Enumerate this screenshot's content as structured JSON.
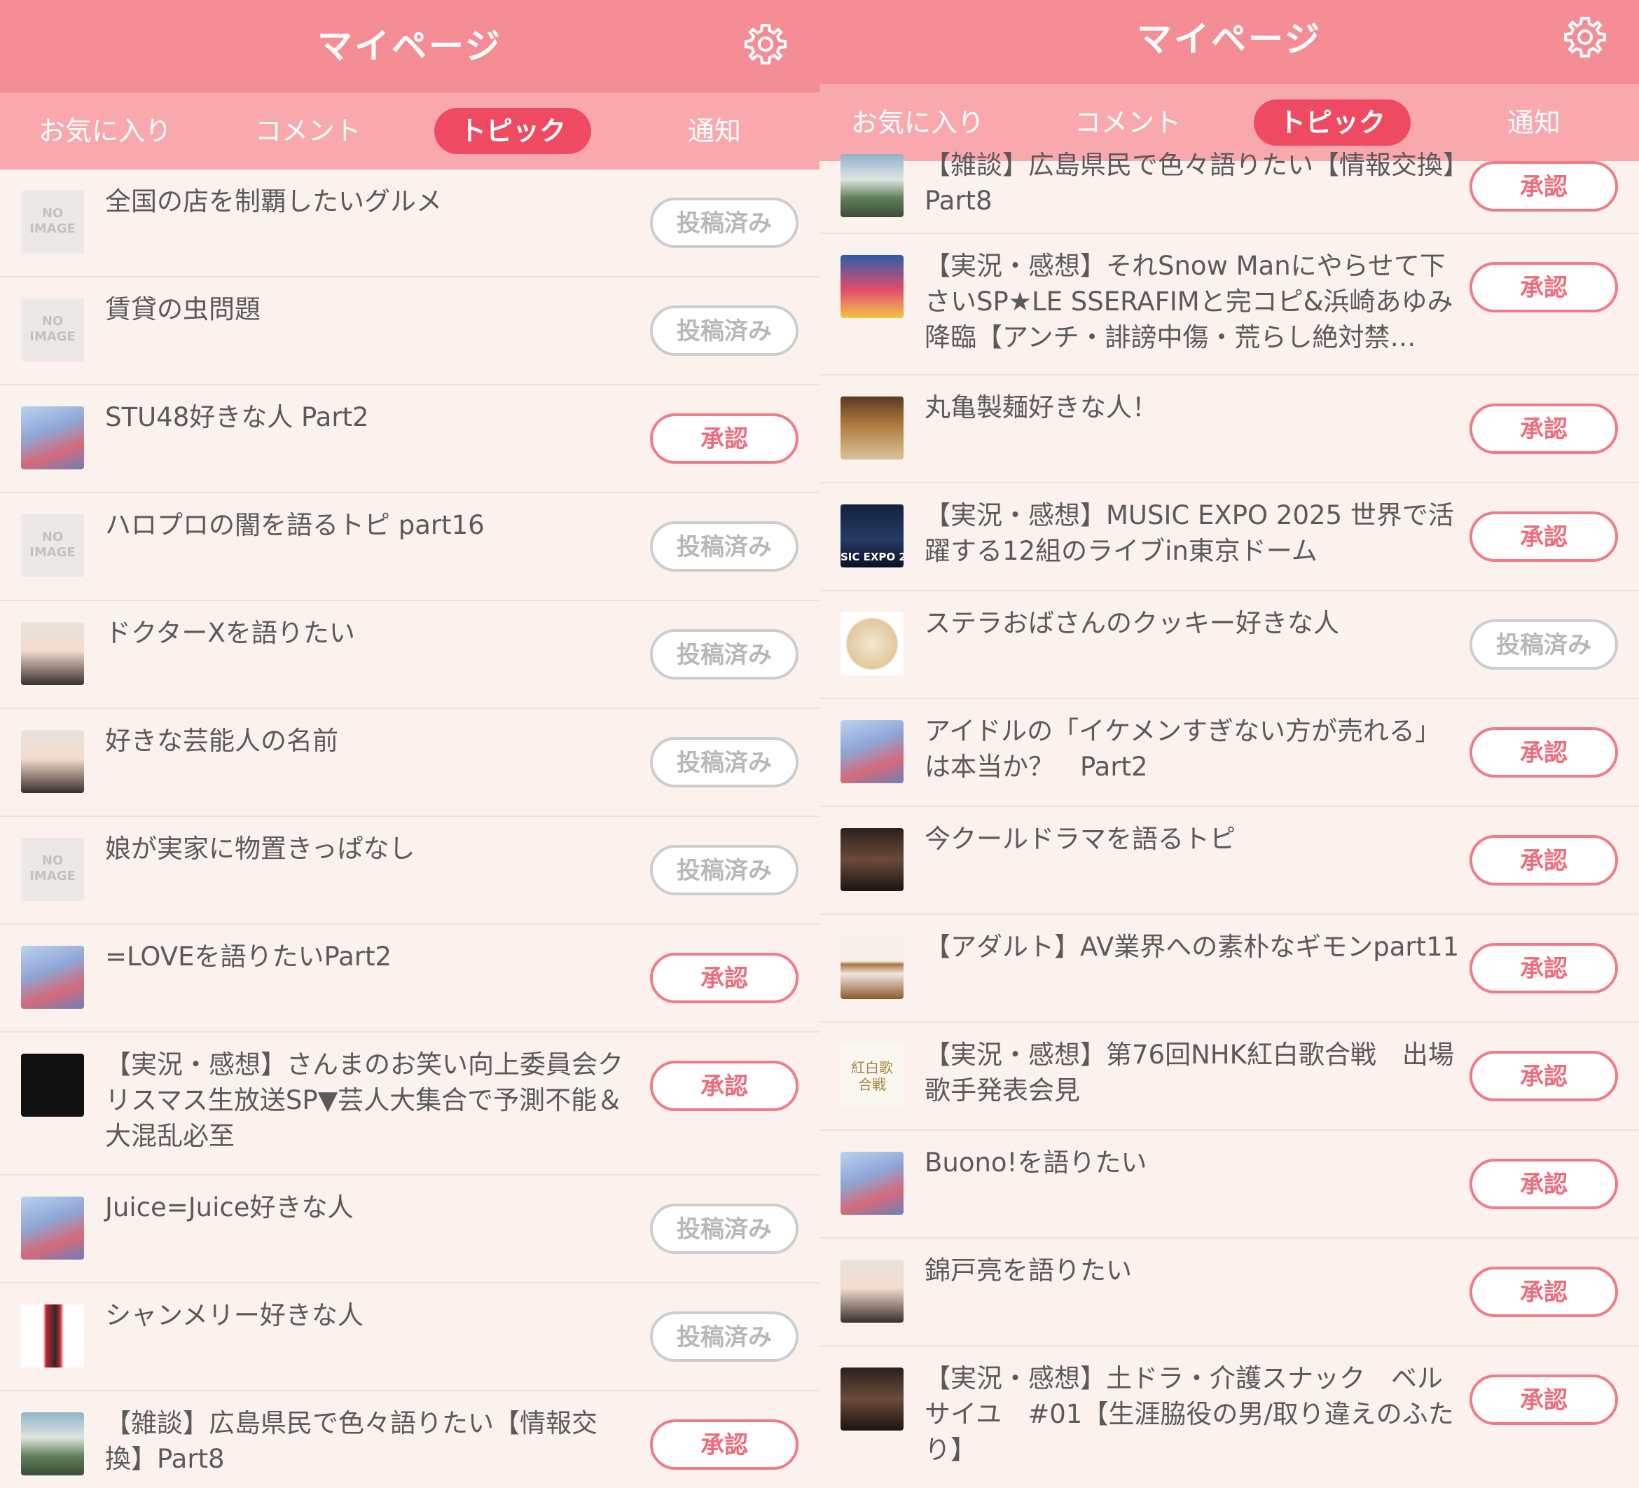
{
  "colors": {
    "header": "#f58d95",
    "tabs_bar": "#f9a9ae",
    "active_tab": "#ee4a61",
    "background": "#fbf2ee",
    "approve": "#ef6c7c",
    "posted": "#b8b8b8"
  },
  "left": {
    "header_title": "マイページ",
    "tabs": [
      "お気に入り",
      "コメント",
      "トピック",
      "通知"
    ],
    "active_tab": "トピック",
    "items": [
      {
        "title": "全国の店を制覇したいグルメ",
        "status": "投稿済み",
        "thumb": "no-image"
      },
      {
        "title": "賃貸の虫問題",
        "status": "投稿済み",
        "thumb": "no-image"
      },
      {
        "title": "STU48好きな人 Part2",
        "status": "承認",
        "thumb": "group-photo"
      },
      {
        "title": "ハロプロの闇を語るトピ part16",
        "status": "投稿済み",
        "thumb": "no-image"
      },
      {
        "title": "ドクターXを語りたい",
        "status": "投稿済み",
        "thumb": "portrait"
      },
      {
        "title": "好きな芸能人の名前",
        "status": "投稿済み",
        "thumb": "portrait"
      },
      {
        "title": "娘が実家に物置きっぱなし",
        "status": "投稿済み",
        "thumb": "no-image"
      },
      {
        "title": "=LOVEを語りたいPart2",
        "status": "承認",
        "thumb": "group-photo"
      },
      {
        "title": "【実況・感想】さんまのお笑い向上委員会クリスマス生放送SP▼芸人大集合で予測不能＆大混乱必至",
        "status": "承認",
        "thumb": "show-logo"
      },
      {
        "title": "Juice=Juice好きな人",
        "status": "投稿済み",
        "thumb": "group-photo"
      },
      {
        "title": "シャンメリー好きな人",
        "status": "投稿済み",
        "thumb": "bottle"
      },
      {
        "title": "【雑談】広島県民で色々語りたい【情報交換】Part8",
        "status": "承認",
        "thumb": "city"
      }
    ],
    "no_image_label": [
      "NO",
      "IMAGE"
    ]
  },
  "right": {
    "header_title": "マイページ",
    "tabs": [
      "お気に入り",
      "コメント",
      "トピック",
      "通知"
    ],
    "active_tab": "トピック",
    "items": [
      {
        "title": "【雑談】広島県民で色々語りたい【情報交換】Part8",
        "status": "承認",
        "thumb": "city"
      },
      {
        "title": "【実況・感想】それSnow Manにやらせて下さいSP★LE SSERAFIMと完コピ&浜崎あゆみ降臨【アンチ・誹謗中傷・荒らし絶対禁…",
        "status": "承認",
        "thumb": "tv-show"
      },
      {
        "title": "丸亀製麺好きな人！",
        "status": "承認",
        "thumb": "noodles"
      },
      {
        "title": "【実況・感想】MUSIC EXPO 2025 世界で活躍する12組のライブin東京ドーム",
        "status": "承認",
        "thumb": "music-expo",
        "thumb_text": "SIC EXPO 2"
      },
      {
        "title": "ステラおばさんのクッキー好きな人",
        "status": "投稿済み",
        "thumb": "cookie-logo"
      },
      {
        "title": "アイドルの「イケメンすぎない方が売れる」は本当か？　Part2",
        "status": "承認",
        "thumb": "group-photo"
      },
      {
        "title": "今クールドラマを語るトピ",
        "status": "承認",
        "thumb": "drama-poster"
      },
      {
        "title": "【アダルト】AV業界への素朴なギモンpart11",
        "status": "承認",
        "thumb": "bed"
      },
      {
        "title": "【実況・感想】第76回NHK紅白歌合戦　出場歌手発表会見",
        "status": "承認",
        "thumb": "kohaku-logo",
        "thumb_text": "紅白歌合戦"
      },
      {
        "title": "Buono!を語りたい",
        "status": "承認",
        "thumb": "group-photo"
      },
      {
        "title": "錦戸亮を語りたい",
        "status": "承認",
        "thumb": "portrait"
      },
      {
        "title": "【実況・感想】土ドラ・介護スナック　ベルサイユ　#01【生涯脇役の男/取り違えのふたり】",
        "status": "承認",
        "thumb": "drama-poster"
      }
    ]
  }
}
